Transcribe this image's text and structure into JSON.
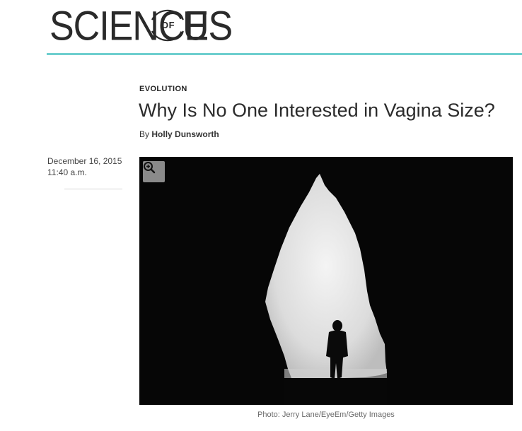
{
  "site": {
    "logo_word_1": "SCIENCE",
    "logo_of": "OF",
    "logo_word_2": "US",
    "accent_color": "#6fcfcf"
  },
  "article": {
    "section": "EVOLUTION",
    "headline": "Why Is No One Interested in Vagina Size?",
    "byline_prefix": "By",
    "author": "Holly Dunsworth",
    "date": "December 16, 2015",
    "time": "11:40 a.m."
  },
  "image": {
    "zoom_icon": "zoom-in-icon",
    "caption": "Photo: Jerry Lane/EyeEm/Getty Images"
  }
}
